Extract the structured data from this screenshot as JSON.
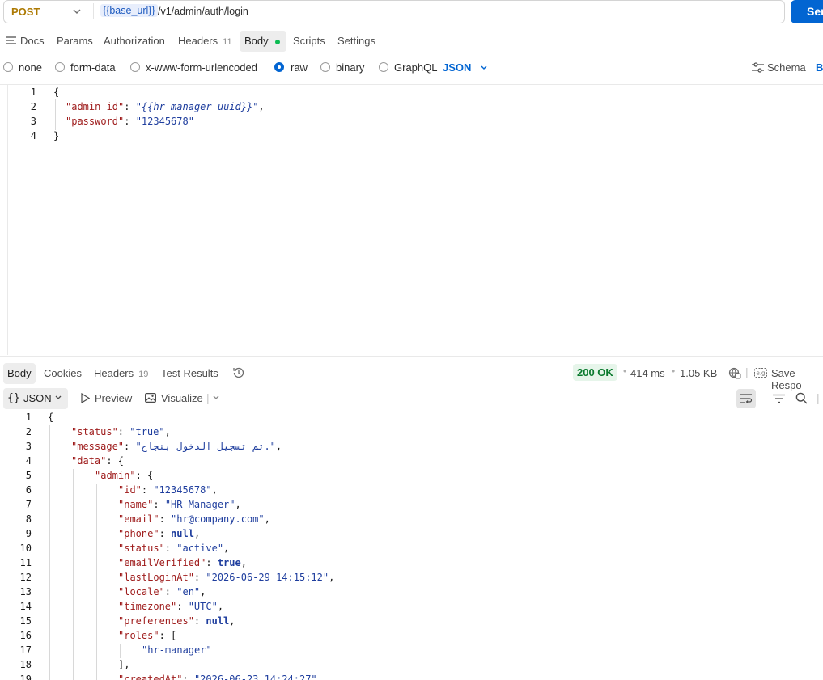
{
  "request": {
    "method": "POST",
    "url_variable": "{{base_url}}",
    "url_path": "/v1/admin/auth/login",
    "send_label": "Send",
    "send_visible": "Sen"
  },
  "request_tabs": [
    {
      "label": "Docs"
    },
    {
      "label": "Params"
    },
    {
      "label": "Authorization"
    },
    {
      "label": "Headers",
      "count": "11"
    },
    {
      "label": "Body"
    },
    {
      "label": "Scripts"
    },
    {
      "label": "Settings"
    }
  ],
  "body_options": {
    "none": "none",
    "form_data": "form-data",
    "urlencoded": "x-www-form-urlencoded",
    "raw": "raw",
    "binary": "binary",
    "graphql": "GraphQL",
    "format": "JSON",
    "schema": "Schema",
    "beautify_cut": "B"
  },
  "request_body": {
    "line_numbers": [
      "1",
      "2",
      "3",
      "4"
    ],
    "k_admin_id": "\"admin_id\"",
    "v_admin_id": "\"{{hr_manager_uuid}}\"",
    "k_password": "\"password\"",
    "v_password": "\"12345678\""
  },
  "response_tabs": [
    {
      "label": "Body"
    },
    {
      "label": "Cookies"
    },
    {
      "label": "Headers",
      "count": "19"
    },
    {
      "label": "Test Results"
    }
  ],
  "response_meta": {
    "status": "200 OK",
    "time": "414 ms",
    "size": "1.05 KB",
    "save_label": "Save Respo"
  },
  "response_toolbar": {
    "format": "JSON",
    "preview": "Preview",
    "visualize": "Visualize"
  },
  "response_body": {
    "line_numbers": [
      "1",
      "2",
      "3",
      "4",
      "5",
      "6",
      "7",
      "8",
      "9",
      "10",
      "11",
      "12",
      "13",
      "14",
      "15",
      "16",
      "17",
      "18",
      "19"
    ],
    "status_key": "\"status\"",
    "status_val": "\"true\"",
    "message_key": "\"message\"",
    "message_val": "\"تم تسجيل الدخول بنجاح.\"",
    "data_key": "\"data\"",
    "admin_key": "\"admin\"",
    "id_key": "\"id\"",
    "id_val": "\"12345678\"",
    "name_key": "\"name\"",
    "name_val": "\"HR Manager\"",
    "email_key": "\"email\"",
    "email_val": "\"hr@company.com\"",
    "phone_key": "\"phone\"",
    "phone_val": "null",
    "st_key": "\"status\"",
    "st_val": "\"active\"",
    "ev_key": "\"emailVerified\"",
    "ev_val": "true",
    "ll_key": "\"lastLoginAt\"",
    "ll_val": "\"2026-06-29 14:15:12\"",
    "locale_key": "\"locale\"",
    "locale_val": "\"en\"",
    "tz_key": "\"timezone\"",
    "tz_val": "\"UTC\"",
    "pref_key": "\"preferences\"",
    "pref_val": "null",
    "roles_key": "\"roles\"",
    "role_0": "\"hr-manager\"",
    "created_key": "\"createdAt\"",
    "created_val": "\"2026-06-23 14:24:27\""
  }
}
